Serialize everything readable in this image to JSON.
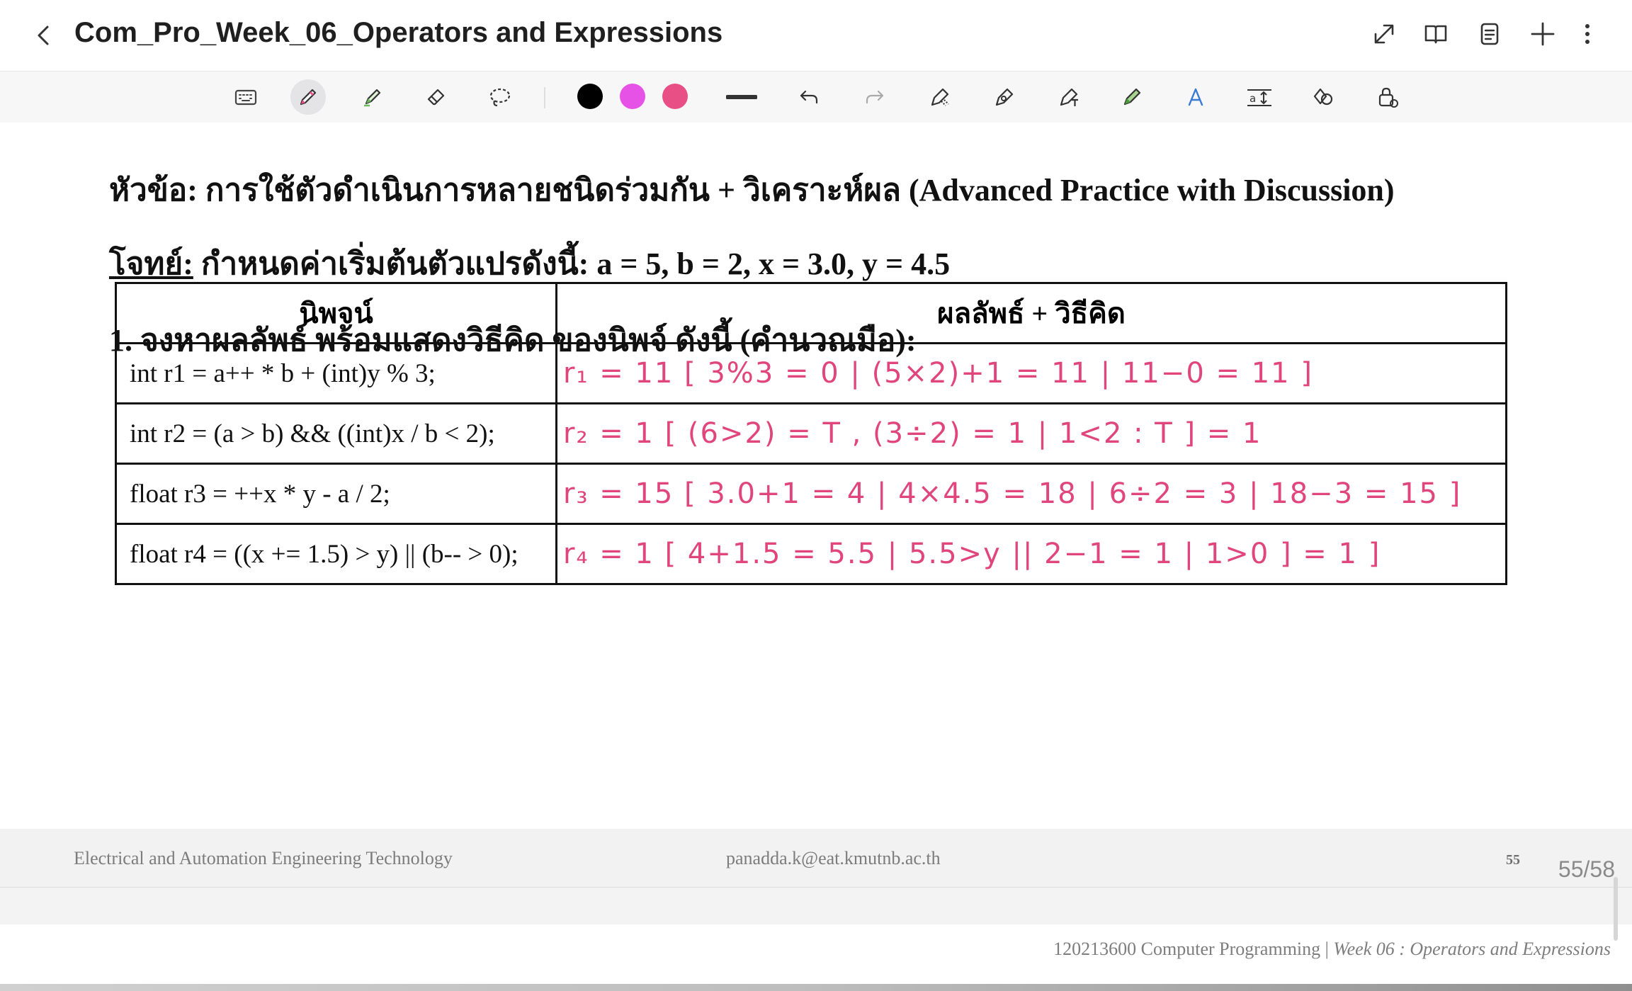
{
  "header": {
    "title": "Com_Pro_Week_06_Operators and Expressions",
    "icons": [
      "back-chevron-icon",
      "expand-icon",
      "book-icon",
      "document-list-icon",
      "plus-icon",
      "more-vertical-icon"
    ]
  },
  "toolbar": {
    "tools": [
      "keyboard-icon",
      "pen-icon",
      "highlighter-icon",
      "eraser-icon",
      "lasso-icon"
    ],
    "active_tool": "pen-icon",
    "colors": [
      "#000000",
      "#e651e6",
      "#e84f84"
    ],
    "stroke_width": "thick",
    "actions": [
      "undo-icon",
      "redo-icon",
      "pen-settings-icon",
      "shape-pen-icon",
      "text-pen-icon",
      "marker-icon",
      "text-style-icon",
      "text-size-icon",
      "shapes-icon",
      "lock-icon"
    ]
  },
  "slide": {
    "heading1": "หัวข้อ: การใช้ตัวดำเนินการหลายชนิดร่วมกัน + วิเคราะห์ผล (Advanced Practice with Discussion)",
    "heading2_label": "โจทย์:",
    "heading2_text": " กำหนดค่าเริ่มต้นตัวแปรดังนี้: a = 5, b = 2, x = 3.0, y = 4.5",
    "heading3": "1. จงหาผลลัพธ์ พร้อมแสดงวิธีคิด ของนิพจ์ ดังนี้ (คำนวณมือ):",
    "table": {
      "headers": [
        "นิพจน์",
        "ผลลัพธ์ + วิธีคิด"
      ],
      "rows": [
        {
          "expr": "int r1 = a++ * b + (int)y % 3;",
          "answer": "r₁ = 11 [ 3%3 = 0 | (5×2)+1 = 11 | 11−0 = 11 ]"
        },
        {
          "expr": "int r2 = (a > b) && ((int)x / b < 2);",
          "answer": "r₂ = 1 [ (6>2) = T , (3÷2) = 1 | 1<2 : T ] = 1"
        },
        {
          "expr": "float r3 = ++x * y - a / 2;",
          "answer": "r₃ = 15 [ 3.0+1 = 4 | 4×4.5 = 18 | 6÷2 = 3 | 18−3 = 15 ]"
        },
        {
          "expr": "float r4 = ((x += 1.5) > y) || (b-- > 0);",
          "answer": "r₄ = 1 [ 4+1.5 = 5.5 | 5.5>y || 2−1 = 1 | 1>0 ] = 1 ]"
        }
      ]
    },
    "footer_left": "Electrical and Automation Engineering Technology",
    "footer_center": "panadda.k@eat.kmutnb.ac.th",
    "slide_number": "55",
    "footer_course": "120213600 Computer Programming | ",
    "footer_week": "Week 06 : Operators and Expressions"
  },
  "page_indicator": "55/58"
}
